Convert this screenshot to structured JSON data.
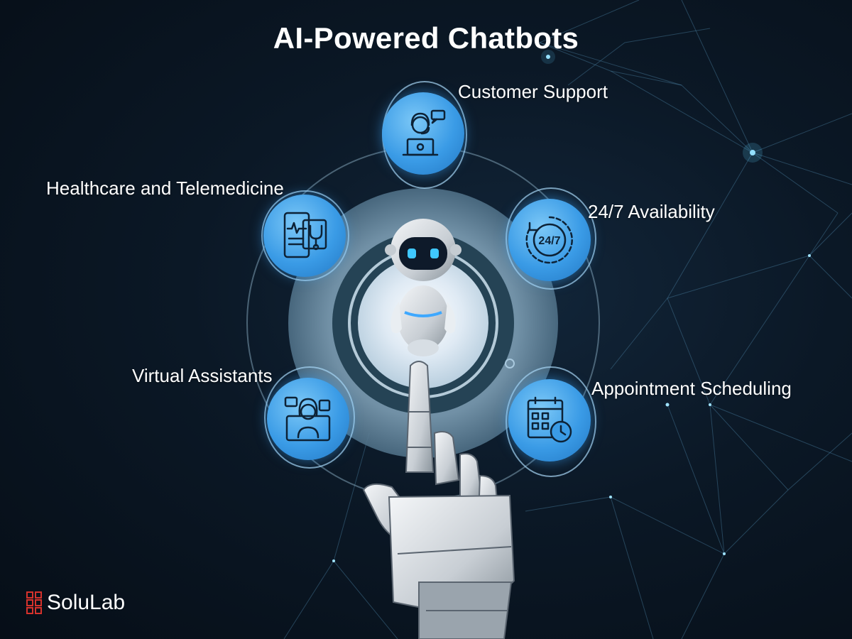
{
  "title": "AI-Powered Chatbots",
  "items": [
    {
      "label": "Customer Support",
      "icon": "customer-support-agent-icon"
    },
    {
      "label": "Healthcare and Telemedicine",
      "icon": "healthcare-telemedicine-icon"
    },
    {
      "label": "24/7 Availability",
      "icon": "clock-24-7-icon"
    },
    {
      "label": "Virtual Assistants",
      "icon": "virtual-assistant-icon"
    },
    {
      "label": "Appointment Scheduling",
      "icon": "calendar-clock-icon"
    }
  ],
  "clock_text": "24/7",
  "brand": {
    "name": "SoluLab"
  },
  "colors": {
    "background": "#0b1826",
    "node_blue": "#3a9be6",
    "ring": "#8fb4c8",
    "logo_red": "#d6322c"
  }
}
